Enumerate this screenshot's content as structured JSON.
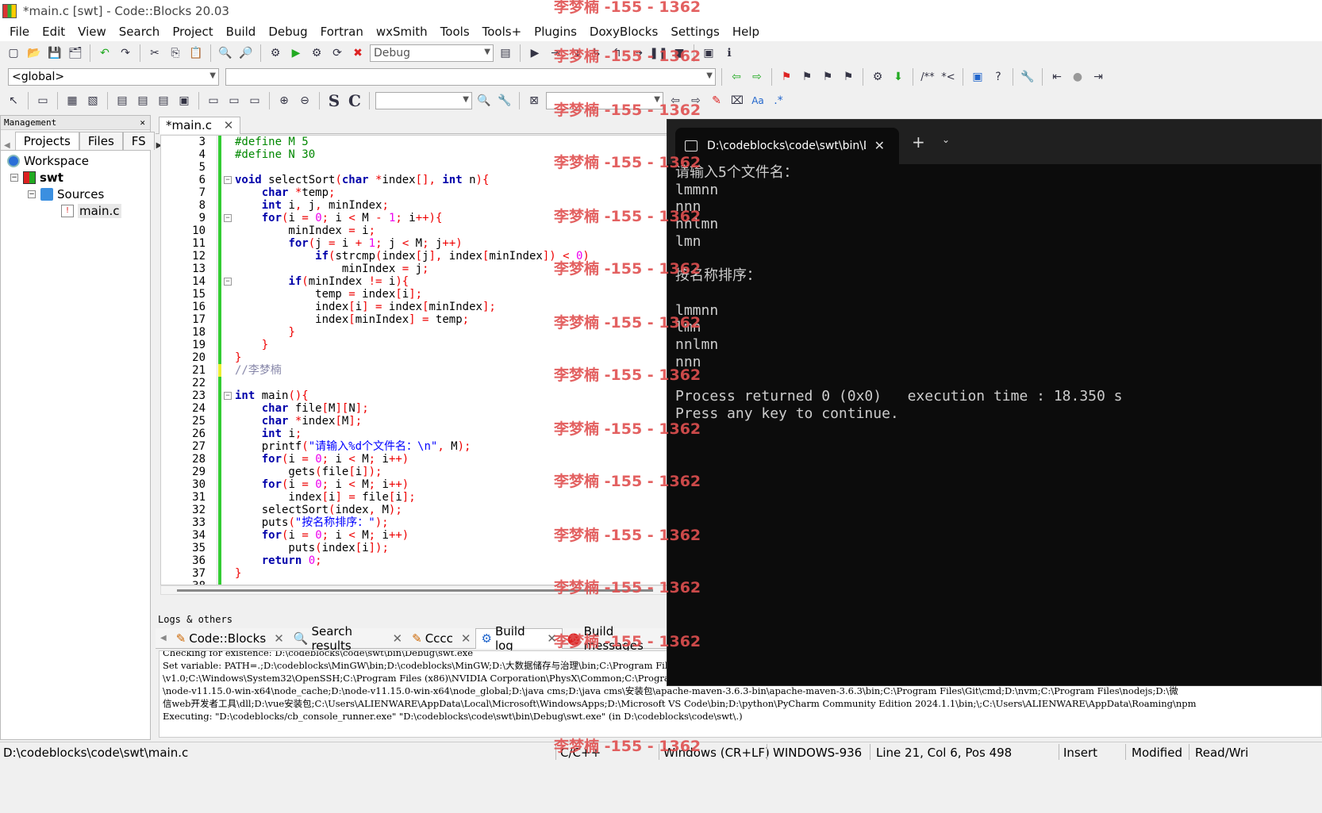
{
  "window": {
    "title": "*main.c [swt] - Code::Blocks 20.03"
  },
  "menu": [
    "File",
    "Edit",
    "View",
    "Search",
    "Project",
    "Build",
    "Debug",
    "Fortran",
    "wxSmith",
    "Tools",
    "Tools+",
    "Plugins",
    "DoxyBlocks",
    "Settings",
    "Help"
  ],
  "toolbar": {
    "build_target": "Debug",
    "scope": "<global>",
    "code_completion_symbols": [
      "S",
      "C"
    ],
    "doxy_labels": [
      "/**",
      "*<"
    ]
  },
  "management": {
    "title": "Management",
    "tabs": [
      "Projects",
      "Files",
      "FS"
    ],
    "tree": {
      "workspace": "Workspace",
      "project": "swt",
      "folder": "Sources",
      "file": "main.c"
    }
  },
  "editor": {
    "tab_label": "*main.c",
    "lines": [
      {
        "n": "3"
      },
      {
        "n": "4"
      },
      {
        "n": "5"
      },
      {
        "n": "6"
      },
      {
        "n": "7"
      },
      {
        "n": "8"
      },
      {
        "n": "9"
      },
      {
        "n": "10"
      },
      {
        "n": "11"
      },
      {
        "n": "12"
      },
      {
        "n": "13"
      },
      {
        "n": "14"
      },
      {
        "n": "15"
      },
      {
        "n": "16"
      },
      {
        "n": "17"
      },
      {
        "n": "18"
      },
      {
        "n": "19"
      },
      {
        "n": "20"
      },
      {
        "n": "21"
      },
      {
        "n": "22"
      },
      {
        "n": "23"
      },
      {
        "n": "24"
      },
      {
        "n": "25"
      },
      {
        "n": "26"
      },
      {
        "n": "27"
      },
      {
        "n": "28"
      },
      {
        "n": "29"
      },
      {
        "n": "30"
      },
      {
        "n": "31"
      },
      {
        "n": "32"
      },
      {
        "n": "33"
      },
      {
        "n": "34"
      },
      {
        "n": "35"
      },
      {
        "n": "36"
      },
      {
        "n": "37"
      },
      {
        "n": "38"
      }
    ]
  },
  "logs": {
    "title": "Logs & others",
    "tabs": [
      "Code::Blocks",
      "Search results",
      "Cccc",
      "Build log",
      "Build messages"
    ],
    "lines": [
      "Checking for existence: D:\\codeblocks\\code\\swt\\bin\\Debug\\swt.exe",
      "Set variable: PATH=.;D:\\codeblocks\\MinGW\\bin;D:\\codeblocks\\MinGW;D:\\大数据储存与治理\\bin;C:\\Program Files\\Common Files\\Oracle\\Java\\javapath;C:\\Windows\\system32;C:\\Windows;C:\\Windows\\System32\\Wbem;C:\\Windows\\System32\\WindowsPowerShell",
      "\\v1.0;C:\\Windows\\System32\\OpenSSH;C:\\Program Files (x86)\\NVIDIA Corporation\\PhysX\\Common;C:\\Program Files\\NVIDIA Corporation\\NVIDIA NvDLISR;D:\\MySQL\\MySQL Server 8.0\\bin;D:\\nodejs;D:\\node-v11.15.0-win-x64;D:\\node-v11.15.0-win-x64\\node_global;D:",
      "\\node-v11.15.0-win-x64\\node_cache;D:\\node-v11.15.0-win-x64\\node_global;D:\\java cms;D:\\java cms\\安装包\\apache-maven-3.6.3-bin\\apache-maven-3.6.3\\bin;C:\\Program Files\\Git\\cmd;D:\\nvm;C:\\Program Files\\nodejs;D:\\微",
      "信web开发者工具\\dll;D:\\vue安装包;C:\\Users\\ALIENWARE\\AppData\\Local\\Microsoft\\WindowsApps;D:\\Microsoft VS Code\\bin;D:\\python\\PyCharm Community Edition 2024.1.1\\bin;\\;C:\\Users\\ALIENWARE\\AppData\\Roaming\\npm",
      "Executing: \"D:\\codeblocks/cb_console_runner.exe\" \"D:\\codeblocks\\code\\swt\\bin\\Debug\\swt.exe\"  (in D:\\codeblocks\\code\\swt\\.)"
    ]
  },
  "status": {
    "path": "D:\\codeblocks\\code\\swt\\main.c",
    "language": "C/C++",
    "eol": "Windows (CR+LF)",
    "encoding": "WINDOWS-936",
    "position": "Line 21, Col 6, Pos 498",
    "mode": "Insert",
    "modified": "Modified",
    "rw": "Read/Wri"
  },
  "terminal": {
    "tab_title": "D:\\codeblocks\\code\\swt\\bin\\D",
    "lines": [
      "请输入5个文件名：",
      "lmmnn",
      "nnn",
      "nnlmn",
      "lmn",
      "",
      "按名称排序：",
      "",
      "lmmnn",
      "lmn",
      "nnlmn",
      "nnn",
      "",
      "Process returned 0 (0x0)   execution time : 18.350 s",
      "Press any key to continue."
    ]
  },
  "watermark": "李梦楠 -155 - 1362",
  "colors": {
    "keyword": "#0000aa",
    "preprocessor": "#008800",
    "operator": "#ee0000",
    "number": "#ee00ee",
    "string": "#0000ff",
    "comment": "#8888aa",
    "terminal_bg": "#0c0c0c",
    "watermark": "#e05050"
  }
}
